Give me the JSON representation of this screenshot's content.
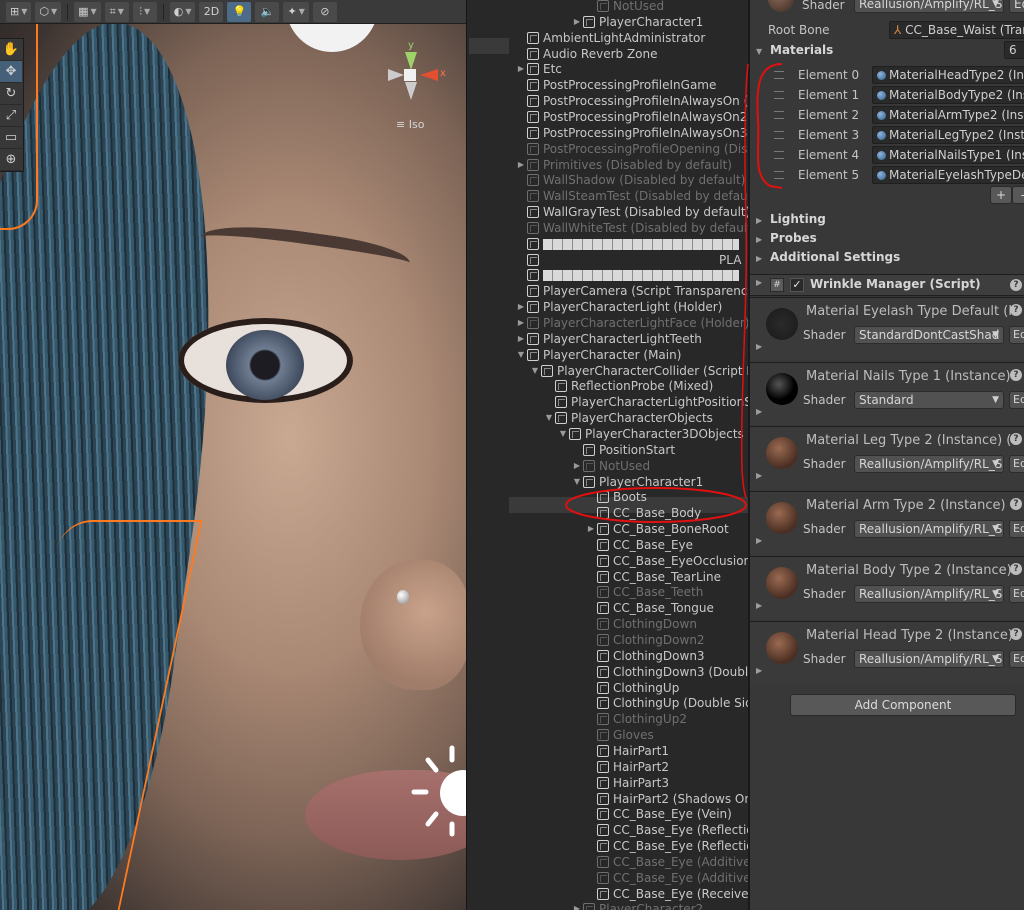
{
  "toolbar": {
    "two_d_label": "2D"
  },
  "gizmo": {
    "y_label": "y",
    "x_label": "x",
    "iso_label": "Iso"
  },
  "hierarchy": {
    "rows": [
      {
        "text": "NotUsed",
        "depth": 5,
        "arrow": "",
        "dim": true
      },
      {
        "text": "PlayerCharacter1",
        "depth": 4,
        "arrow": "▶",
        "dim": false
      },
      {
        "text": "AmbientLightAdministrator",
        "depth": 0,
        "arrow": "",
        "dim": false
      },
      {
        "text": "Audio Reverb Zone",
        "depth": 0,
        "arrow": "",
        "dim": false
      },
      {
        "text": "Etc",
        "depth": 0,
        "arrow": "▶",
        "dim": false
      },
      {
        "text": "PostProcessingProfileInGame",
        "depth": 0,
        "arrow": "",
        "dim": false
      },
      {
        "text": "PostProcessingProfileInAlwaysOn (V",
        "depth": 0,
        "arrow": "",
        "dim": false
      },
      {
        "text": "PostProcessingProfileInAlwaysOn2",
        "depth": 0,
        "arrow": "",
        "dim": false
      },
      {
        "text": "PostProcessingProfileInAlwaysOn3",
        "depth": 0,
        "arrow": "",
        "dim": false
      },
      {
        "text": "PostProcessingProfileOpening (Disa",
        "depth": 0,
        "arrow": "",
        "dim": true
      },
      {
        "text": "Primitives (Disabled by default)",
        "depth": 0,
        "arrow": "▶",
        "dim": true
      },
      {
        "text": "WallShadow (Disabled by default)",
        "depth": 0,
        "arrow": "",
        "dim": true
      },
      {
        "text": "WallSteamTest (Disabled by default",
        "depth": 0,
        "arrow": "",
        "dim": true
      },
      {
        "text": "WallGrayTest (Disabled by default)",
        "depth": 0,
        "arrow": "",
        "dim": false
      },
      {
        "text": "WallWhiteTest (Disabled by default",
        "depth": 0,
        "arrow": "",
        "dim": true
      },
      {
        "text": "",
        "depth": 0,
        "arrow": "",
        "dim": false,
        "bar": 196
      },
      {
        "text": "PLA",
        "depth": 0,
        "arrow": "",
        "dim": false,
        "pad": 176
      },
      {
        "text": "",
        "depth": 0,
        "arrow": "",
        "dim": false,
        "bar": 196
      },
      {
        "text": "PlayerCamera (Script Transparency",
        "depth": 0,
        "arrow": "",
        "dim": false
      },
      {
        "text": "PlayerCharacterLight (Holder)",
        "depth": 0,
        "arrow": "▶",
        "dim": false
      },
      {
        "text": "PlayerCharacterLightFace (Holder) (",
        "depth": 0,
        "arrow": "▶",
        "dim": true
      },
      {
        "text": "PlayerCharacterLightTeeth",
        "depth": 0,
        "arrow": "▶",
        "dim": false
      },
      {
        "text": "PlayerCharacter (Main)",
        "depth": 0,
        "arrow": "▼",
        "dim": false
      },
      {
        "text": "PlayerCharacterCollider (Script P",
        "depth": 1,
        "arrow": "▼",
        "dim": false
      },
      {
        "text": "ReflectionProbe (Mixed)",
        "depth": 2,
        "arrow": "",
        "dim": false
      },
      {
        "text": "PlayerCharacterLightPositionS",
        "depth": 2,
        "arrow": "",
        "dim": false
      },
      {
        "text": "PlayerCharacterObjects",
        "depth": 2,
        "arrow": "▼",
        "dim": false
      },
      {
        "text": "PlayerCharacter3DObjects",
        "depth": 3,
        "arrow": "▼",
        "dim": false
      },
      {
        "text": "PositionStart",
        "depth": 4,
        "arrow": "",
        "dim": false
      },
      {
        "text": "NotUsed",
        "depth": 4,
        "arrow": "▶",
        "dim": true
      },
      {
        "text": "PlayerCharacter1",
        "depth": 4,
        "arrow": "▼",
        "dim": false
      },
      {
        "text": "Boots",
        "depth": 5,
        "arrow": "",
        "dim": false
      },
      {
        "text": "CC_Base_Body",
        "depth": 5,
        "arrow": "",
        "dim": false
      },
      {
        "text": "CC_Base_BoneRoot",
        "depth": 5,
        "arrow": "▶",
        "dim": false
      },
      {
        "text": "CC_Base_Eye",
        "depth": 5,
        "arrow": "",
        "dim": false
      },
      {
        "text": "CC_Base_EyeOcclusion",
        "depth": 5,
        "arrow": "",
        "dim": false
      },
      {
        "text": "CC_Base_TearLine",
        "depth": 5,
        "arrow": "",
        "dim": false
      },
      {
        "text": "CC_Base_Teeth",
        "depth": 5,
        "arrow": "",
        "dim": true
      },
      {
        "text": "CC_Base_Tongue",
        "depth": 5,
        "arrow": "",
        "dim": false
      },
      {
        "text": "ClothingDown",
        "depth": 5,
        "arrow": "",
        "dim": true
      },
      {
        "text": "ClothingDown2",
        "depth": 5,
        "arrow": "",
        "dim": true
      },
      {
        "text": "ClothingDown3",
        "depth": 5,
        "arrow": "",
        "dim": false
      },
      {
        "text": "ClothingDown3 (Double",
        "depth": 5,
        "arrow": "",
        "dim": false
      },
      {
        "text": "ClothingUp",
        "depth": 5,
        "arrow": "",
        "dim": false
      },
      {
        "text": "ClothingUp (Double Sid",
        "depth": 5,
        "arrow": "",
        "dim": false
      },
      {
        "text": "ClothingUp2",
        "depth": 5,
        "arrow": "",
        "dim": true
      },
      {
        "text": "Gloves",
        "depth": 5,
        "arrow": "",
        "dim": true
      },
      {
        "text": "HairPart1",
        "depth": 5,
        "arrow": "",
        "dim": false
      },
      {
        "text": "HairPart2",
        "depth": 5,
        "arrow": "",
        "dim": false
      },
      {
        "text": "HairPart3",
        "depth": 5,
        "arrow": "",
        "dim": false
      },
      {
        "text": "HairPart2 (Shadows On",
        "depth": 5,
        "arrow": "",
        "dim": false
      },
      {
        "text": "CC_Base_Eye (Vein)",
        "depth": 5,
        "arrow": "",
        "dim": false
      },
      {
        "text": "CC_Base_Eye (Reflectio",
        "depth": 5,
        "arrow": "",
        "dim": false
      },
      {
        "text": "CC_Base_Eye (Reflectio",
        "depth": 5,
        "arrow": "",
        "dim": false
      },
      {
        "text": "CC_Base_Eye (Additive",
        "depth": 5,
        "arrow": "",
        "dim": true
      },
      {
        "text": "CC_Base_Eye (Additive",
        "depth": 5,
        "arrow": "",
        "dim": true
      },
      {
        "text": "CC_Base_Eye (Receive",
        "depth": 5,
        "arrow": "",
        "dim": false
      },
      {
        "text": "PlayerCharacter2",
        "depth": 4,
        "arrow": "▶",
        "dim": true
      }
    ]
  },
  "inspector": {
    "shader_label": "Shader",
    "shader_value": "Reallusion/Amplify/RL_S",
    "edit_label": "Ed",
    "root_bone_label": "Root Bone",
    "root_bone_value": "CC_Base_Waist (Tran",
    "materials_label": "Materials",
    "materials_count": "6",
    "elements": [
      {
        "label": "Element 0",
        "value": "MaterialHeadType2 (Inst"
      },
      {
        "label": "Element 1",
        "value": "MaterialBodyType2 (Inst"
      },
      {
        "label": "Element 2",
        "value": "MaterialArmType2 (Insta"
      },
      {
        "label": "Element 3",
        "value": "MaterialLegType2 (Insta"
      },
      {
        "label": "Element 4",
        "value": "MaterialNailsType1 (Insta"
      },
      {
        "label": "Element 5",
        "value": "MaterialEyelashTypeDef"
      }
    ],
    "plus_label": "+",
    "minus_label": "-",
    "foldouts": [
      "Lighting",
      "Probes",
      "Additional Settings"
    ],
    "component_title": "Wrinkle Manager (Script)",
    "component_icon": "#",
    "materials": [
      {
        "name": "Material Eyelash Type Default (I",
        "shader_value": "StandardDontCastShad",
        "dim": true
      },
      {
        "name": "Material Nails Type 1 (Instance)",
        "shader_value": "Standard",
        "dim": false
      },
      {
        "name": "Material Leg Type 2 (Instance) (",
        "shader_value": "Reallusion/Amplify/RL_S",
        "dim": false
      },
      {
        "name": "Material Arm Type 2 (Instance)",
        "shader_value": "Reallusion/Amplify/RL_S",
        "dim": false
      },
      {
        "name": "Material Body Type 2 (Instance)",
        "shader_value": "Reallusion/Amplify/RL_S",
        "dim": false
      },
      {
        "name": "Material Head Type 2 (Instance)",
        "shader_value": "Reallusion/Amplify/RL_S",
        "dim": false
      }
    ],
    "help_label": "?",
    "add_component_label": "Add Component"
  },
  "colors": {
    "selection_outline": "#ff7a1f",
    "annotation_red": "#e01010"
  }
}
